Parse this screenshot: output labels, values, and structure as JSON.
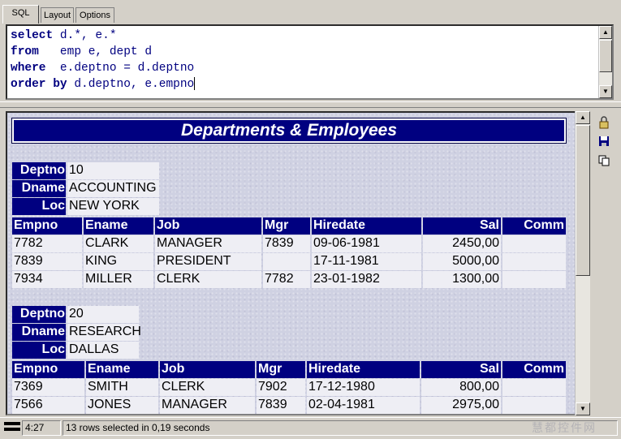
{
  "tabs": [
    "SQL",
    "Layout",
    "Options"
  ],
  "sql": {
    "lines": [
      {
        "kw": "select",
        "rest": " d.*, e.*"
      },
      {
        "kw": "from",
        "rest": "   emp e, dept d"
      },
      {
        "kw": "where",
        "rest": "  e.deptno = d.deptno"
      },
      {
        "kw": "order by",
        "rest": " d.deptno, e.empno"
      }
    ]
  },
  "report": {
    "title": "Departments & Employees",
    "dept_labels": {
      "deptno": "Deptno",
      "dname": "Dname",
      "loc": "Loc"
    },
    "emp_headers": {
      "empno": "Empno",
      "ename": "Ename",
      "job": "Job",
      "mgr": "Mgr",
      "hiredate": "Hiredate",
      "sal": "Sal",
      "comm": "Comm"
    },
    "departments": [
      {
        "deptno": "10",
        "dname": "ACCOUNTING",
        "loc": "NEW YORK",
        "employees": [
          {
            "empno": "7782",
            "ename": "CLARK",
            "job": "MANAGER",
            "mgr": "7839",
            "hiredate": "09-06-1981",
            "sal": "2450,00",
            "comm": ""
          },
          {
            "empno": "7839",
            "ename": "KING",
            "job": "PRESIDENT",
            "mgr": "",
            "hiredate": "17-11-1981",
            "sal": "5000,00",
            "comm": ""
          },
          {
            "empno": "7934",
            "ename": "MILLER",
            "job": "CLERK",
            "mgr": "7782",
            "hiredate": "23-01-1982",
            "sal": "1300,00",
            "comm": ""
          }
        ]
      },
      {
        "deptno": "20",
        "dname": "RESEARCH",
        "loc": "DALLAS",
        "employees": [
          {
            "empno": "7369",
            "ename": "SMITH",
            "job": "CLERK",
            "mgr": "7902",
            "hiredate": "17-12-1980",
            "sal": "800,00",
            "comm": ""
          },
          {
            "empno": "7566",
            "ename": "JONES",
            "job": "MANAGER",
            "mgr": "7839",
            "hiredate": "02-04-1981",
            "sal": "2975,00",
            "comm": ""
          }
        ]
      }
    ]
  },
  "status": {
    "position": "4:27",
    "message": "13 rows selected in 0,19 seconds",
    "watermark": "慧都控件网"
  },
  "icons": {
    "tools": [
      "lock-icon",
      "save-icon",
      "copy-icon"
    ]
  },
  "colors": {
    "header_bg": "#000080",
    "cell_bg": "#eeeef4"
  }
}
